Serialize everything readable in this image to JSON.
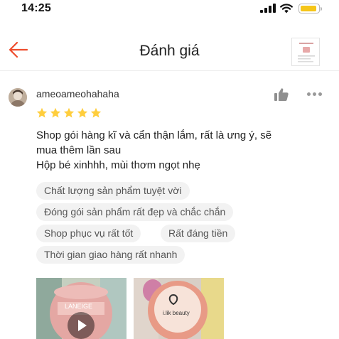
{
  "status_bar": {
    "time": "14:25",
    "battery_color": "#f5c518",
    "icons": [
      "signal-icon",
      "wifi-icon",
      "battery-icon"
    ]
  },
  "header": {
    "title": "Đánh giá",
    "back_icon": "arrow-left-icon",
    "accent_color": "#ee4d2d"
  },
  "review": {
    "username": "ameoameohahaha",
    "rating": 5,
    "star_color": "#ffce3d",
    "text_lines": [
      "Shop gói hàng kĩ và cẩn thận lắm, rất là ưng ý, sẽ",
      "mua thêm lần sau",
      "Hộp bé xinhhh, mùi thơm ngọt nhẹ"
    ],
    "tags": [
      "Chất lượng sản phẩm tuyệt vời",
      "Đóng gói sản phẩm rất đẹp và chắc chắn",
      "Shop phục vụ rất tốt",
      "Rất đáng tiền",
      "Thời gian giao hàng rất nhanh"
    ],
    "media": [
      {
        "type": "video",
        "label": "LANEIGE"
      },
      {
        "type": "photo",
        "label": "i.lik beauty"
      }
    ]
  }
}
